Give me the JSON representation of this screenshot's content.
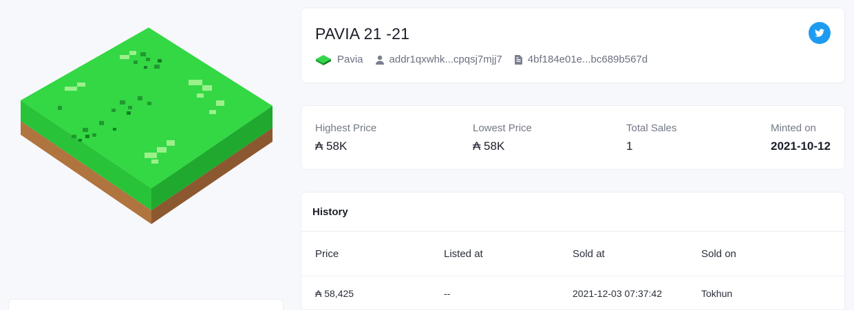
{
  "nft": {
    "title": "PAVIA 21 -21",
    "collection": "Pavia",
    "owner_address": "addr1qxwhk...cpqsj7mjj7",
    "policy_id": "4bf184e01e...bc689b567d",
    "image_alt": "isometric-land-tile"
  },
  "icons": {
    "twitter": "twitter-icon",
    "collection": "pavia-tile-icon",
    "owner": "user-icon",
    "policy": "document-icon"
  },
  "colors": {
    "twitter": "#1d9bf0",
    "grass": "#2fcf3f",
    "grass_side": "#27b835",
    "dirt": "#a96b3a",
    "dirt_dark": "#8a5530"
  },
  "stats": {
    "highest_label": "Highest Price",
    "highest_value": "₳ 58K",
    "lowest_label": "Lowest Price",
    "lowest_value": "₳ 58K",
    "sales_label": "Total Sales",
    "sales_value": "1",
    "minted_label": "Minted on",
    "minted_value": "2021-10-12"
  },
  "history": {
    "title": "History",
    "columns": [
      "Price",
      "Listed at",
      "Sold at",
      "Sold on"
    ],
    "rows": [
      {
        "price": "₳ 58,425",
        "listed_at": "--",
        "sold_at": "2021-12-03 07:37:42",
        "sold_on": "Tokhun"
      }
    ]
  }
}
